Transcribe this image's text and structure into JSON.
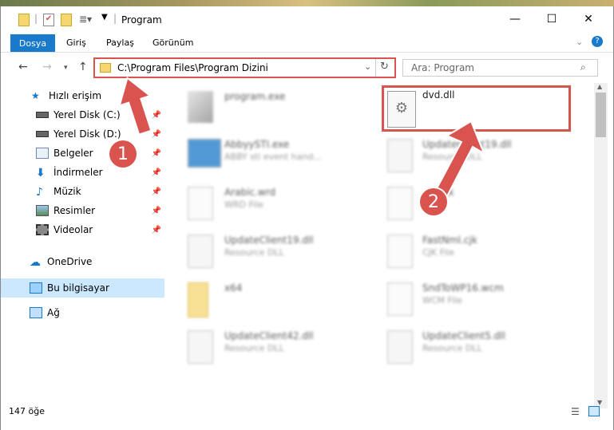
{
  "window": {
    "title": "Program",
    "minimize": "—",
    "maximize": "☐",
    "close": "✕"
  },
  "ribbon": {
    "file": "Dosya",
    "tabs": [
      "Giriş",
      "Paylaş",
      "Görünüm"
    ]
  },
  "address": {
    "path": "C:\\Program Files\\Program Dizini",
    "search_placeholder": "Ara: Program"
  },
  "sidebar": {
    "quick": "Hızlı erişim",
    "items": [
      "Yerel Disk (C:)",
      "Yerel Disk (D:)",
      "Belgeler",
      "İndirmeler",
      "Müzik",
      "Resimler",
      "Videolar"
    ],
    "onedrive": "OneDrive",
    "thispc": "Bu bilgisayar",
    "network": "Ağ"
  },
  "files": [
    {
      "name": "program.exe",
      "desc": ""
    },
    {
      "name": "dvd.dll",
      "desc": ""
    },
    {
      "name": "AbbyySTI.exe",
      "desc": "ABBY sti event hand..."
    },
    {
      "name": "UpdateClient19.dll",
      "desc": "Resource DLL"
    },
    {
      "name": "Arabic.wrd",
      "desc": "WRD File"
    },
    {
      "name": "...n.cjk",
      "desc": ""
    },
    {
      "name": "UpdateClient19.dll",
      "desc": "Resource DLL"
    },
    {
      "name": "FastNml.cjk",
      "desc": "CJK File"
    },
    {
      "name": "x64",
      "desc": ""
    },
    {
      "name": "SndToWP16.wcm",
      "desc": "WCM File"
    },
    {
      "name": "UpdateClient42.dll",
      "desc": "Resource DLL"
    },
    {
      "name": "UpdateClient5.dll",
      "desc": "Resource DLL"
    }
  ],
  "status": {
    "count": "147 öğe"
  },
  "annotations": [
    "1",
    "2"
  ],
  "colors": {
    "accent": "#1979ca",
    "highlight": "#d9534f",
    "selection": "#cce8ff"
  }
}
